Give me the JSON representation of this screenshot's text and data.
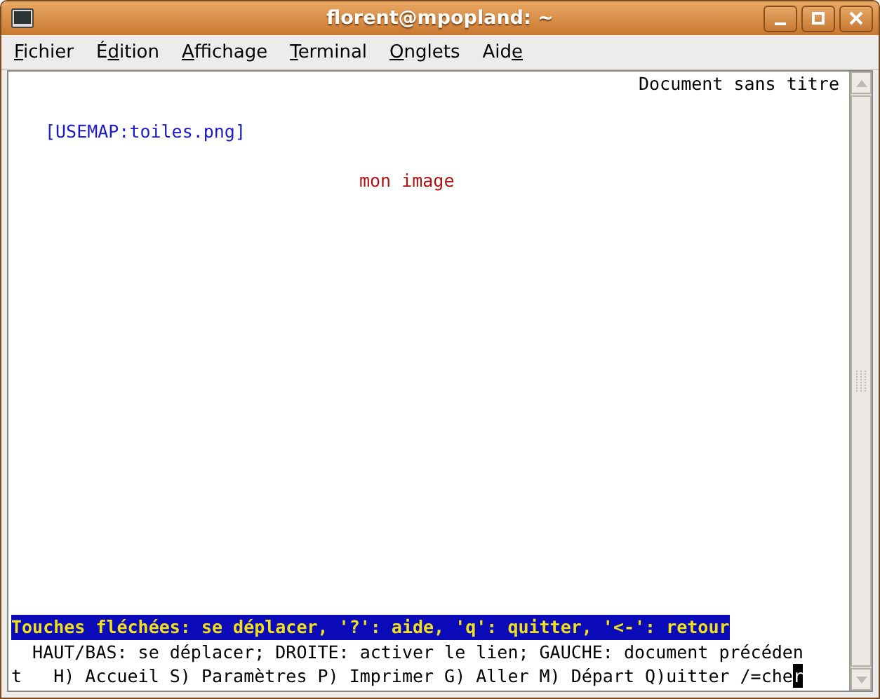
{
  "window": {
    "title": "florent@mpopland: ~"
  },
  "menu": [
    {
      "key": "F",
      "post": "ichier"
    },
    {
      "pre": "É",
      "key": "d",
      "post": "ition"
    },
    {
      "key": "A",
      "post": "ffichage"
    },
    {
      "key": "T",
      "post": "erminal"
    },
    {
      "key": "O",
      "post": "nglets"
    },
    {
      "pre": "Aid",
      "key": "e"
    }
  ],
  "terminal": {
    "doc_title": "Document sans titre",
    "link": "[USEMAP:toiles.png]",
    "image_alt": "mon image",
    "status": "Touches fléchées: se déplacer, '?': aide, 'q': quitter, '<-': retour",
    "help_line": "  HAUT/BAS: se déplacer; DROITE: activer le lien; GAUCHE: document précéden",
    "command_line": "t   H) Accueil S) Paramètres P) Imprimer G) Aller M) Départ Q)uitter /=che",
    "cursor_char": "r"
  }
}
